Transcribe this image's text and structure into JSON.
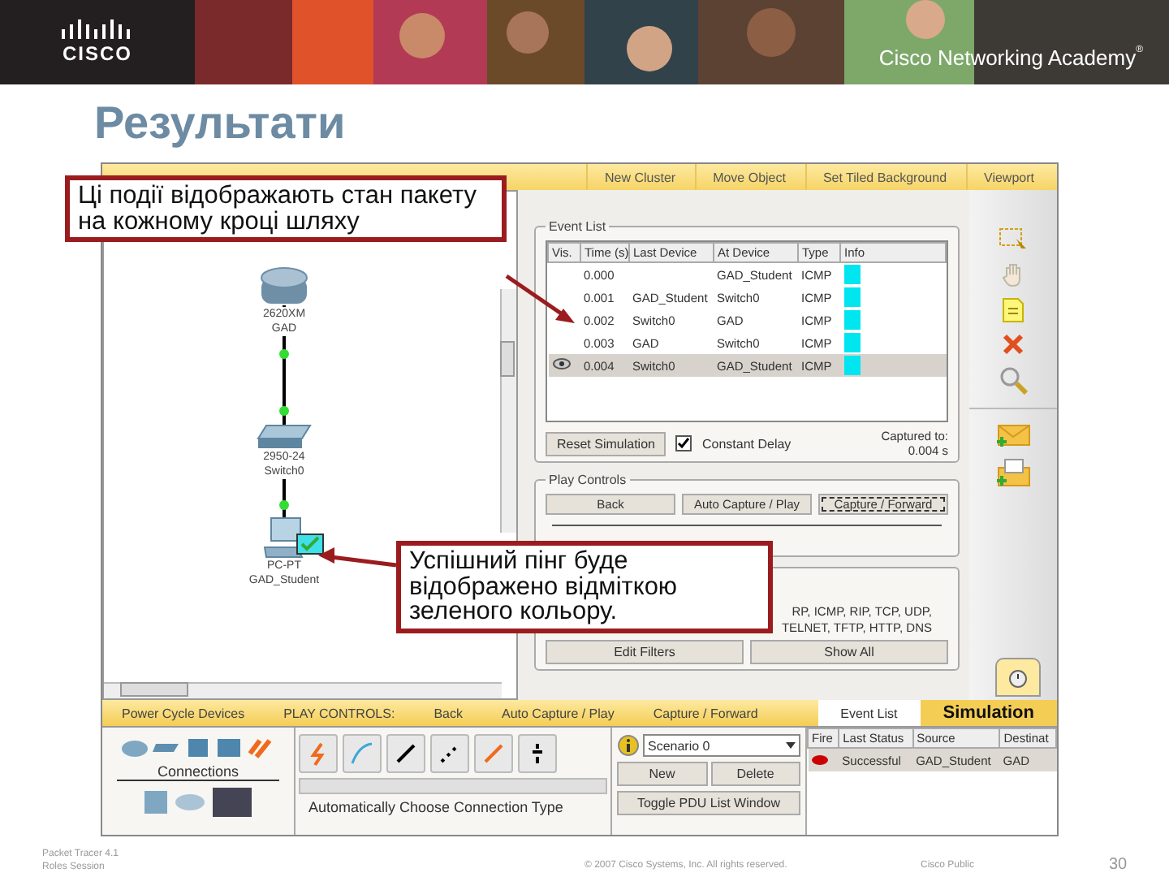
{
  "banner": {
    "logo": "CISCO",
    "academy": "Cisco Networking Academy",
    "academy_mark": "®"
  },
  "title": "Результати",
  "toolbar": [
    "New Cluster",
    "Move Object",
    "Set Tiled Background",
    "Viewport"
  ],
  "topology": {
    "nodes": [
      {
        "kind": "router",
        "model": "2620XM",
        "name": "GAD"
      },
      {
        "kind": "switch",
        "model": "2950-24",
        "name": "Switch0"
      },
      {
        "kind": "pc",
        "model": "PC-PT",
        "name": "GAD_Student"
      }
    ]
  },
  "event_list": {
    "title": "Event List",
    "columns": [
      "Vis.",
      "Time (s)",
      "Last Device",
      "At Device",
      "Type",
      "Info"
    ],
    "rows": [
      {
        "time": "0.000",
        "at_device": "GAD_Student",
        "type": "ICMP",
        "selected": false
      },
      {
        "time": "0.001",
        "last_device": "GAD_Student",
        "at_device": "Switch0",
        "type": "ICMP",
        "selected": false
      },
      {
        "time": "0.002",
        "last_device": "Switch0",
        "at_device": "GAD",
        "type": "ICMP",
        "selected": false
      },
      {
        "time": "0.003",
        "last_device": "GAD",
        "at_device": "Switch0",
        "type": "ICMP",
        "selected": false
      },
      {
        "time": "0.004",
        "last_device": "Switch0",
        "at_device": "GAD_Student",
        "type": "ICMP",
        "selected": true
      }
    ]
  },
  "reset_button": "Reset Simulation",
  "constant_delay": {
    "label": "Constant Delay",
    "checked": true
  },
  "captured": {
    "label": "Captured to:",
    "value": "0.004 s"
  },
  "play_controls": {
    "title": "Play Controls",
    "buttons": [
      "Back",
      "Auto Capture / Play",
      "Capture / Forward"
    ]
  },
  "filters": {
    "lines": [
      "RP, ICMP, RIP, TCP, UDP,",
      "TELNET, TFTP, HTTP, DNS"
    ],
    "buttons": [
      "Edit Filters",
      "Show All"
    ]
  },
  "bottom_bar": {
    "items": [
      "Power Cycle Devices",
      "PLAY CONTROLS:",
      "Back",
      "Auto Capture / Play",
      "Capture / Forward"
    ],
    "tabs": [
      {
        "label": "Event List",
        "selected": false
      },
      {
        "label": "Simulation",
        "selected": true
      }
    ]
  },
  "devices": {
    "label": "Connections"
  },
  "connection_type": "Automatically Choose Connection Type",
  "scenario": {
    "value": "Scenario 0",
    "buttons": [
      "New",
      "Delete"
    ],
    "toggle": "Toggle PDU List Window"
  },
  "pdu_list": {
    "columns": [
      "Fire",
      "Last Status",
      "Source",
      "Destinat"
    ],
    "rows": [
      {
        "status": "Successful",
        "source": "GAD_Student",
        "destination": "GAD",
        "color": "#cc0000"
      }
    ]
  },
  "callouts": [
    "Ці події відображають стан пакету на кожному кроці шляху",
    "Успішний пінг буде відображено відміткою зеленого кольору."
  ],
  "footer": {
    "left": [
      "Packet Tracer 4.1",
      "Roles Session"
    ],
    "copyright": "© 2007 Cisco Systems, Inc. All rights reserved.",
    "classification": "Cisco Public",
    "page": "30"
  }
}
